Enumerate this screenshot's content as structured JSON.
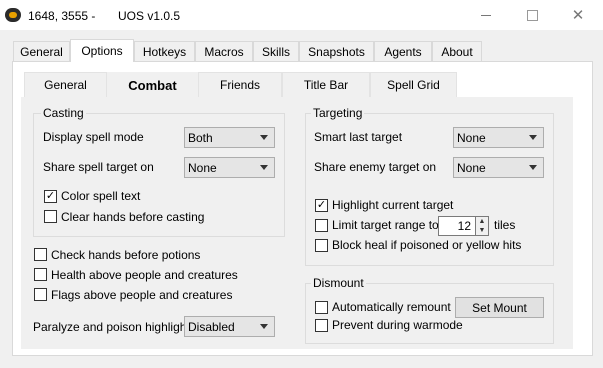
{
  "window": {
    "title": "1648, 3555 -",
    "app_name": "UOS v1.0.5"
  },
  "main_tabs": [
    "General",
    "Options",
    "Hotkeys",
    "Macros",
    "Skills",
    "Snapshots",
    "Agents",
    "About"
  ],
  "active_main_tab": "Options",
  "sub_tabs": [
    "General",
    "Combat",
    "Friends",
    "Title Bar",
    "Spell Grid"
  ],
  "active_sub_tab": "Combat",
  "casting": {
    "title": "Casting",
    "display_spell_mode_label": "Display spell mode",
    "display_spell_mode_value": "Both",
    "share_spell_target_label": "Share spell target on",
    "share_spell_target_value": "None",
    "color_spell_text_label": "Color spell text",
    "color_spell_text_checked": true,
    "clear_hands_label": "Clear hands before casting",
    "clear_hands_checked": false
  },
  "misc": {
    "check_hands_label": "Check hands before potions",
    "health_above_label": "Health above people and creatures",
    "flags_above_label": "Flags above people and creatures",
    "paralyze_label": "Paralyze and poison highlight",
    "paralyze_value": "Disabled"
  },
  "targeting": {
    "title": "Targeting",
    "smart_last_label": "Smart last target",
    "smart_last_value": "None",
    "share_enemy_label": "Share enemy target on",
    "share_enemy_value": "None",
    "highlight_label": "Highlight current target",
    "highlight_checked": true,
    "limit_range_label": "Limit target range to",
    "limit_range_value": "12",
    "tiles_label": "tiles",
    "block_heal_label": "Block heal if poisoned or yellow hits"
  },
  "dismount": {
    "title": "Dismount",
    "auto_remount_label": "Automatically remount",
    "set_mount_label": "Set Mount",
    "prevent_warmode_label": "Prevent during warmode"
  },
  "icons": {
    "minimize": "minimize-icon",
    "maximize": "maximize-icon",
    "close": "close-icon",
    "check": "✓"
  }
}
